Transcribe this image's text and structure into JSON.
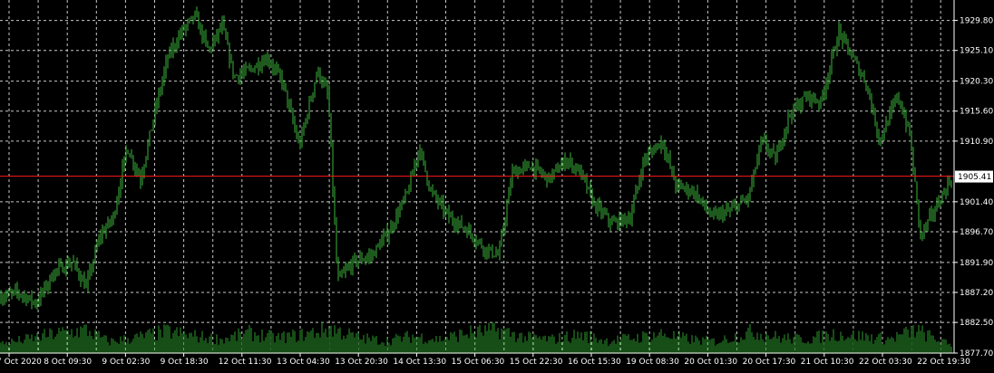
{
  "chart_data": {
    "type": "bar",
    "symbol_price_current": "1905.41",
    "current_price": 1905.41,
    "ylim": [
      1877.7,
      1933.0
    ],
    "y_ticks": [
      {
        "label": "1929.80",
        "value": 1929.8
      },
      {
        "label": "1925.10",
        "value": 1925.1
      },
      {
        "label": "1920.30",
        "value": 1920.3
      },
      {
        "label": "1915.60",
        "value": 1915.6
      },
      {
        "label": "1910.90",
        "value": 1910.9
      },
      {
        "label": "1901.40",
        "value": 1901.4
      },
      {
        "label": "1896.70",
        "value": 1896.7
      },
      {
        "label": "1891.90",
        "value": 1891.9
      },
      {
        "label": "1887.20",
        "value": 1887.2
      },
      {
        "label": "1882.50",
        "value": 1882.5
      },
      {
        "label": "1877.70",
        "value": 1877.7
      }
    ],
    "x_ticks": [
      "7 Oct 2020",
      "8 Oct 09:30",
      "9 Oct 02:30",
      "9 Oct 18:30",
      "12 Oct 11:30",
      "13 Oct 04:30",
      "13 Oct 20:30",
      "14 Oct 13:30",
      "15 Oct 06:30",
      "15 Oct 22:30",
      "16 Oct 15:30",
      "19 Oct 08:30",
      "20 Oct 01:30",
      "20 Oct 17:30",
      "21 Oct 10:30",
      "22 Oct 03:30",
      "22 Oct 19:30"
    ],
    "price_path": [
      [
        0,
        1886.5
      ],
      [
        20,
        1887.2
      ],
      [
        40,
        1885.5
      ],
      [
        60,
        1890.5
      ],
      [
        80,
        1892.0
      ],
      [
        95,
        1888.0
      ],
      [
        110,
        1896.0
      ],
      [
        125,
        1899.0
      ],
      [
        140,
        1910.0
      ],
      [
        155,
        1905.0
      ],
      [
        170,
        1915.0
      ],
      [
        185,
        1924.0
      ],
      [
        200,
        1928.0
      ],
      [
        215,
        1930.5
      ],
      [
        230,
        1925.0
      ],
      [
        245,
        1929.0
      ],
      [
        258,
        1921.0
      ],
      [
        275,
        1922.0
      ],
      [
        295,
        1924.0
      ],
      [
        312,
        1920.0
      ],
      [
        330,
        1910.0
      ],
      [
        350,
        1922.0
      ],
      [
        362,
        1918.0
      ],
      [
        372,
        1889.0
      ],
      [
        390,
        1892.0
      ],
      [
        410,
        1893.0
      ],
      [
        430,
        1897.0
      ],
      [
        450,
        1903.0
      ],
      [
        462,
        1910.0
      ],
      [
        475,
        1903.0
      ],
      [
        495,
        1899.0
      ],
      [
        515,
        1897.0
      ],
      [
        535,
        1894.0
      ],
      [
        550,
        1893.0
      ],
      [
        565,
        1906.0
      ],
      [
        585,
        1907.0
      ],
      [
        605,
        1905.0
      ],
      [
        625,
        1908.0
      ],
      [
        640,
        1906.0
      ],
      [
        655,
        1901.0
      ],
      [
        675,
        1898.0
      ],
      [
        695,
        1899.0
      ],
      [
        710,
        1908.0
      ],
      [
        730,
        1911.0
      ],
      [
        745,
        1904.0
      ],
      [
        765,
        1903.0
      ],
      [
        785,
        1899.0
      ],
      [
        805,
        1900.0
      ],
      [
        825,
        1902.0
      ],
      [
        840,
        1911.0
      ],
      [
        855,
        1908.0
      ],
      [
        870,
        1915.0
      ],
      [
        890,
        1918.0
      ],
      [
        905,
        1917.0
      ],
      [
        925,
        1928.0
      ],
      [
        940,
        1924.0
      ],
      [
        955,
        1920.0
      ],
      [
        970,
        1911.0
      ],
      [
        990,
        1918.0
      ],
      [
        1003,
        1912.0
      ],
      [
        1015,
        1896.0
      ],
      [
        1030,
        1900.0
      ],
      [
        1050,
        1905.4
      ]
    ],
    "volume_path": [
      [
        0,
        12
      ],
      [
        30,
        18
      ],
      [
        60,
        25
      ],
      [
        95,
        30
      ],
      [
        120,
        15
      ],
      [
        150,
        20
      ],
      [
        185,
        28
      ],
      [
        215,
        22
      ],
      [
        245,
        18
      ],
      [
        275,
        26
      ],
      [
        305,
        20
      ],
      [
        335,
        24
      ],
      [
        365,
        32
      ],
      [
        395,
        20
      ],
      [
        425,
        16
      ],
      [
        455,
        22
      ],
      [
        485,
        18
      ],
      [
        515,
        26
      ],
      [
        550,
        30
      ],
      [
        580,
        20
      ],
      [
        610,
        18
      ],
      [
        640,
        24
      ],
      [
        670,
        16
      ],
      [
        700,
        20
      ],
      [
        730,
        25
      ],
      [
        760,
        18
      ],
      [
        790,
        15
      ],
      [
        830,
        28
      ],
      [
        860,
        20
      ],
      [
        890,
        18
      ],
      [
        920,
        25
      ],
      [
        950,
        22
      ],
      [
        980,
        18
      ],
      [
        1010,
        30
      ],
      [
        1040,
        14
      ],
      [
        1050,
        10
      ]
    ]
  }
}
